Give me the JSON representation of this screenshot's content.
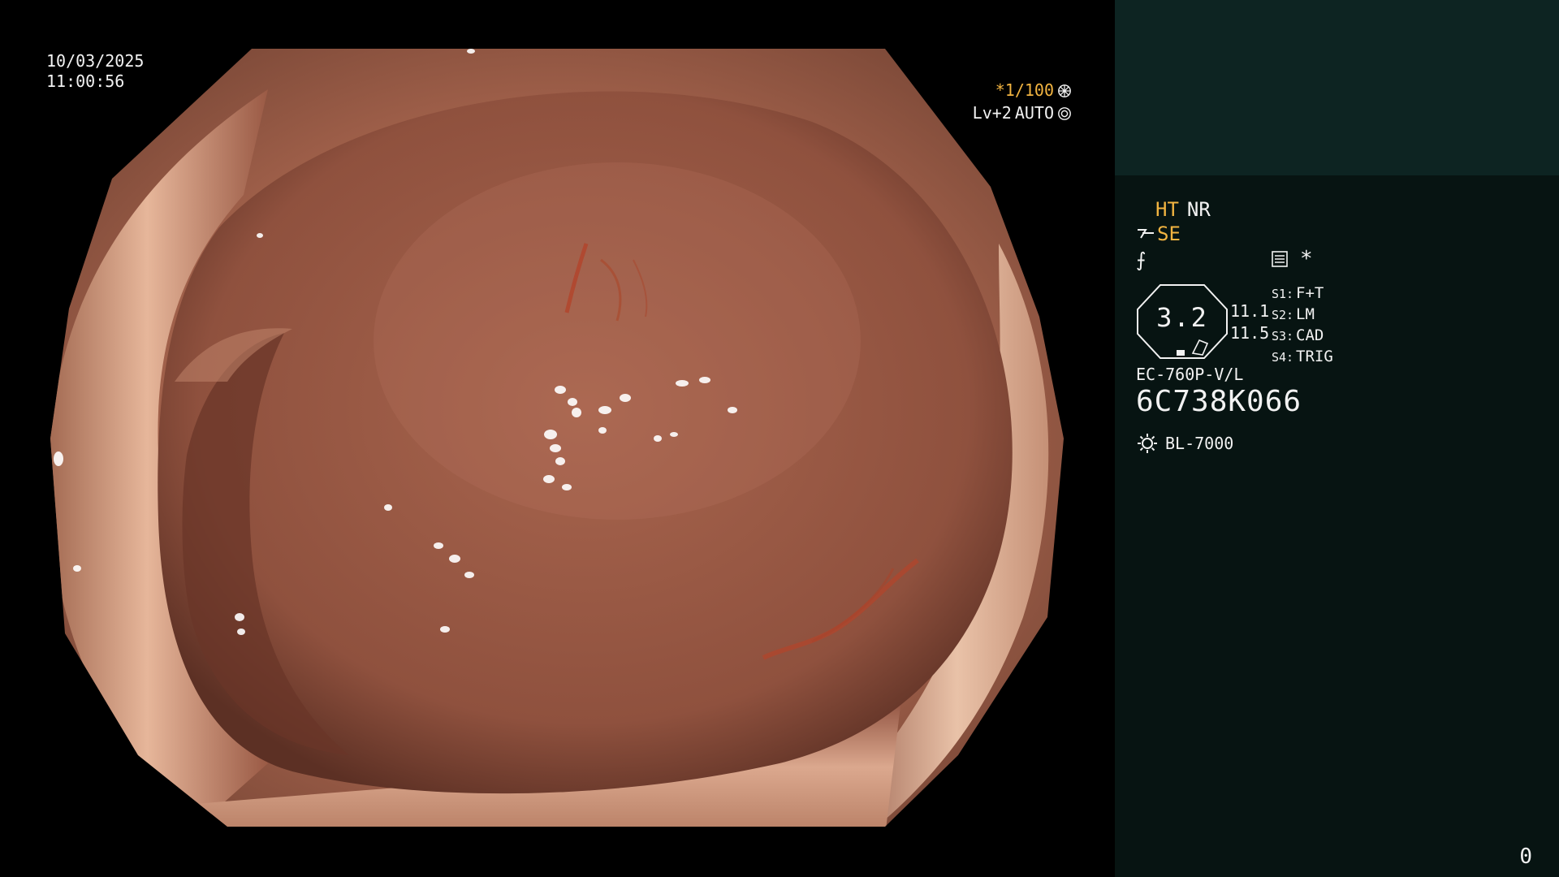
{
  "overlay": {
    "date": "10/03/2025",
    "time": "11:00:56",
    "shutter": "*1/100",
    "level": "Lv+2",
    "iris": "AUTO"
  },
  "info": {
    "mode_ht": "HT",
    "mode_nr": "NR",
    "se": "SE",
    "f_symbol": "⨍",
    "asterisk": "*",
    "zoom": "3.2",
    "side_value_1": "11.1",
    "side_value_2": "11.5",
    "switches": [
      {
        "key": "S1:",
        "value": "F+T"
      },
      {
        "key": "S2:",
        "value": "LM"
      },
      {
        "key": "S3:",
        "value": "CAD"
      },
      {
        "key": "S4:",
        "value": "TRIG"
      }
    ],
    "model": "EC-760P-V/L",
    "serial": "6C738K066",
    "light_source": "BL-7000",
    "corner_number": "0"
  },
  "colors": {
    "accent": "#f2b441",
    "panel_background": "#071412",
    "panel_top_block": "#0d2422",
    "tissue": "#a8614a"
  },
  "icons": [
    "shutter-icon",
    "iris-icon",
    "se-symbol-icon",
    "structure-enhance-icon",
    "memo-icon",
    "light-source-icon"
  ]
}
